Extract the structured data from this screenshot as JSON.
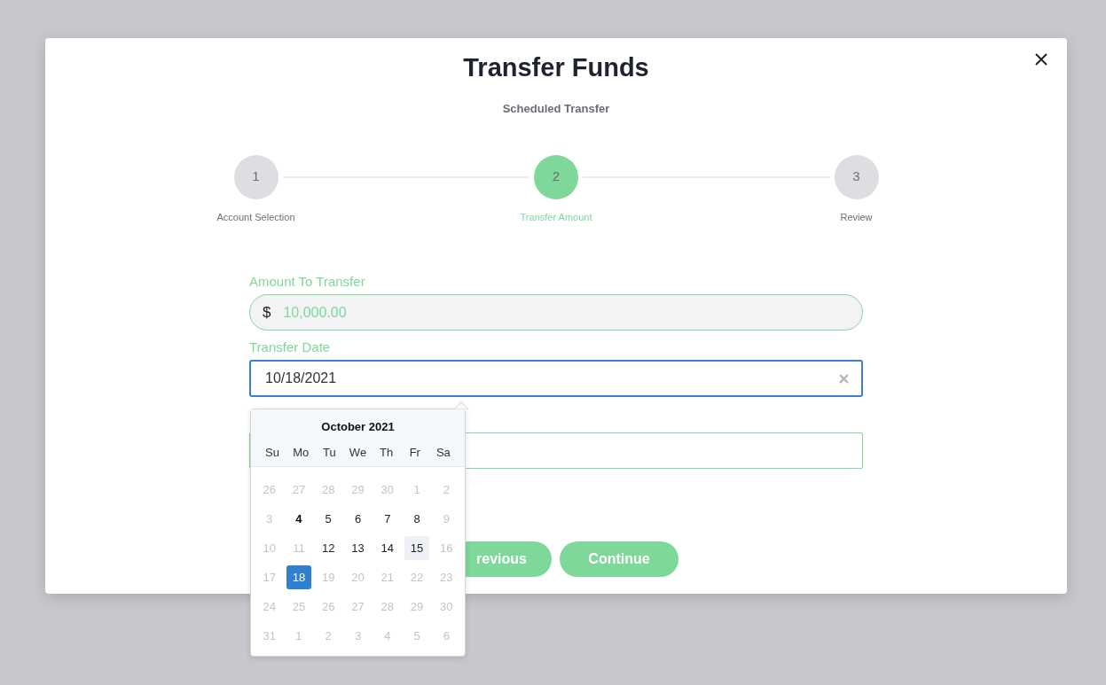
{
  "dialog": {
    "title": "Transfer Funds",
    "subtitle": "Scheduled Transfer"
  },
  "steps": [
    {
      "number": "1",
      "label": "Account Selection",
      "selected": false
    },
    {
      "number": "2",
      "label": "Transfer Amount",
      "selected": true
    },
    {
      "number": "3",
      "label": "Review",
      "selected": false
    }
  ],
  "fields": [
    {
      "kind": "amount",
      "label": "Amount To Transfer",
      "prefix": "$",
      "value": "10,000.00"
    },
    {
      "kind": "date",
      "label": "Transfer Date",
      "value": "10/18/2021",
      "focused": true
    },
    {
      "kind": "text"
    }
  ],
  "datepicker": {
    "title": "October 2021",
    "weekdays": [
      "Su",
      "Mo",
      "Tu",
      "We",
      "Th",
      "Fr",
      "Sa"
    ],
    "weeks": [
      [
        {
          "day": "26",
          "muted": true
        },
        {
          "day": "27",
          "muted": true
        },
        {
          "day": "28",
          "muted": true
        },
        {
          "day": "29",
          "muted": true
        },
        {
          "day": "30",
          "muted": true
        },
        {
          "day": "1",
          "muted": true
        },
        {
          "day": "2",
          "muted": true
        }
      ],
      [
        {
          "day": "3",
          "muted": true
        },
        {
          "day": "4",
          "muted": false,
          "today": true
        },
        {
          "day": "5",
          "muted": false
        },
        {
          "day": "6",
          "muted": false
        },
        {
          "day": "7",
          "muted": false
        },
        {
          "day": "8",
          "muted": false
        },
        {
          "day": "9",
          "muted": true
        }
      ],
      [
        {
          "day": "10",
          "muted": true
        },
        {
          "day": "11",
          "muted": true
        },
        {
          "day": "12",
          "muted": false
        },
        {
          "day": "13",
          "muted": false
        },
        {
          "day": "14",
          "muted": false
        },
        {
          "day": "15",
          "muted": false,
          "hovered": true
        },
        {
          "day": "16",
          "muted": true
        }
      ],
      [
        {
          "day": "17",
          "muted": true
        },
        {
          "day": "18",
          "muted": false,
          "selected": true
        },
        {
          "day": "19",
          "muted": true
        },
        {
          "day": "20",
          "muted": true
        },
        {
          "day": "21",
          "muted": true
        },
        {
          "day": "22",
          "muted": true
        },
        {
          "day": "23",
          "muted": true
        }
      ],
      [
        {
          "day": "24",
          "muted": true
        },
        {
          "day": "25",
          "muted": true
        },
        {
          "day": "26",
          "muted": true
        },
        {
          "day": "27",
          "muted": true
        },
        {
          "day": "28",
          "muted": true
        },
        {
          "day": "29",
          "muted": true
        },
        {
          "day": "30",
          "muted": true
        }
      ],
      [
        {
          "day": "31",
          "muted": true
        },
        {
          "day": "1",
          "muted": true
        },
        {
          "day": "2",
          "muted": true
        },
        {
          "day": "3",
          "muted": true
        },
        {
          "day": "4",
          "muted": true
        },
        {
          "day": "5",
          "muted": true
        },
        {
          "day": "6",
          "muted": true
        }
      ]
    ]
  },
  "buttons": [
    {
      "label": "revious",
      "kind": "secondary"
    },
    {
      "label": "Continue",
      "kind": "primary"
    }
  ]
}
